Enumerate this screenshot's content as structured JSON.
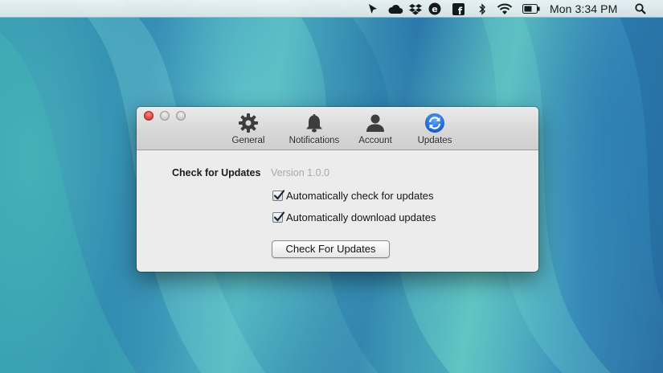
{
  "menubar": {
    "clock": "Mon 3:34 PM",
    "icons": [
      "cursor-arrow-icon",
      "cloud-icon",
      "dropbox-icon",
      "evernote-icon",
      "facebook-icon",
      "bluetooth-icon",
      "wifi-icon",
      "battery-icon",
      "spotlight-search-icon"
    ]
  },
  "window": {
    "tabs": [
      {
        "label": "General",
        "icon": "gear-icon"
      },
      {
        "label": "Notifications",
        "icon": "bell-icon"
      },
      {
        "label": "Account",
        "icon": "person-icon"
      },
      {
        "label": "Updates",
        "icon": "refresh-icon",
        "selected": true
      }
    ],
    "section_label": "Check for Updates",
    "version": "Version 1.0.0",
    "options": [
      {
        "label": "Automatically check for updates",
        "checked": true
      },
      {
        "label": "Automatically download updates",
        "checked": true
      }
    ],
    "check_button_label": "Check For Updates"
  },
  "colors": {
    "updates_accent": "#1f6fd6",
    "close_red": "#e0443a"
  }
}
